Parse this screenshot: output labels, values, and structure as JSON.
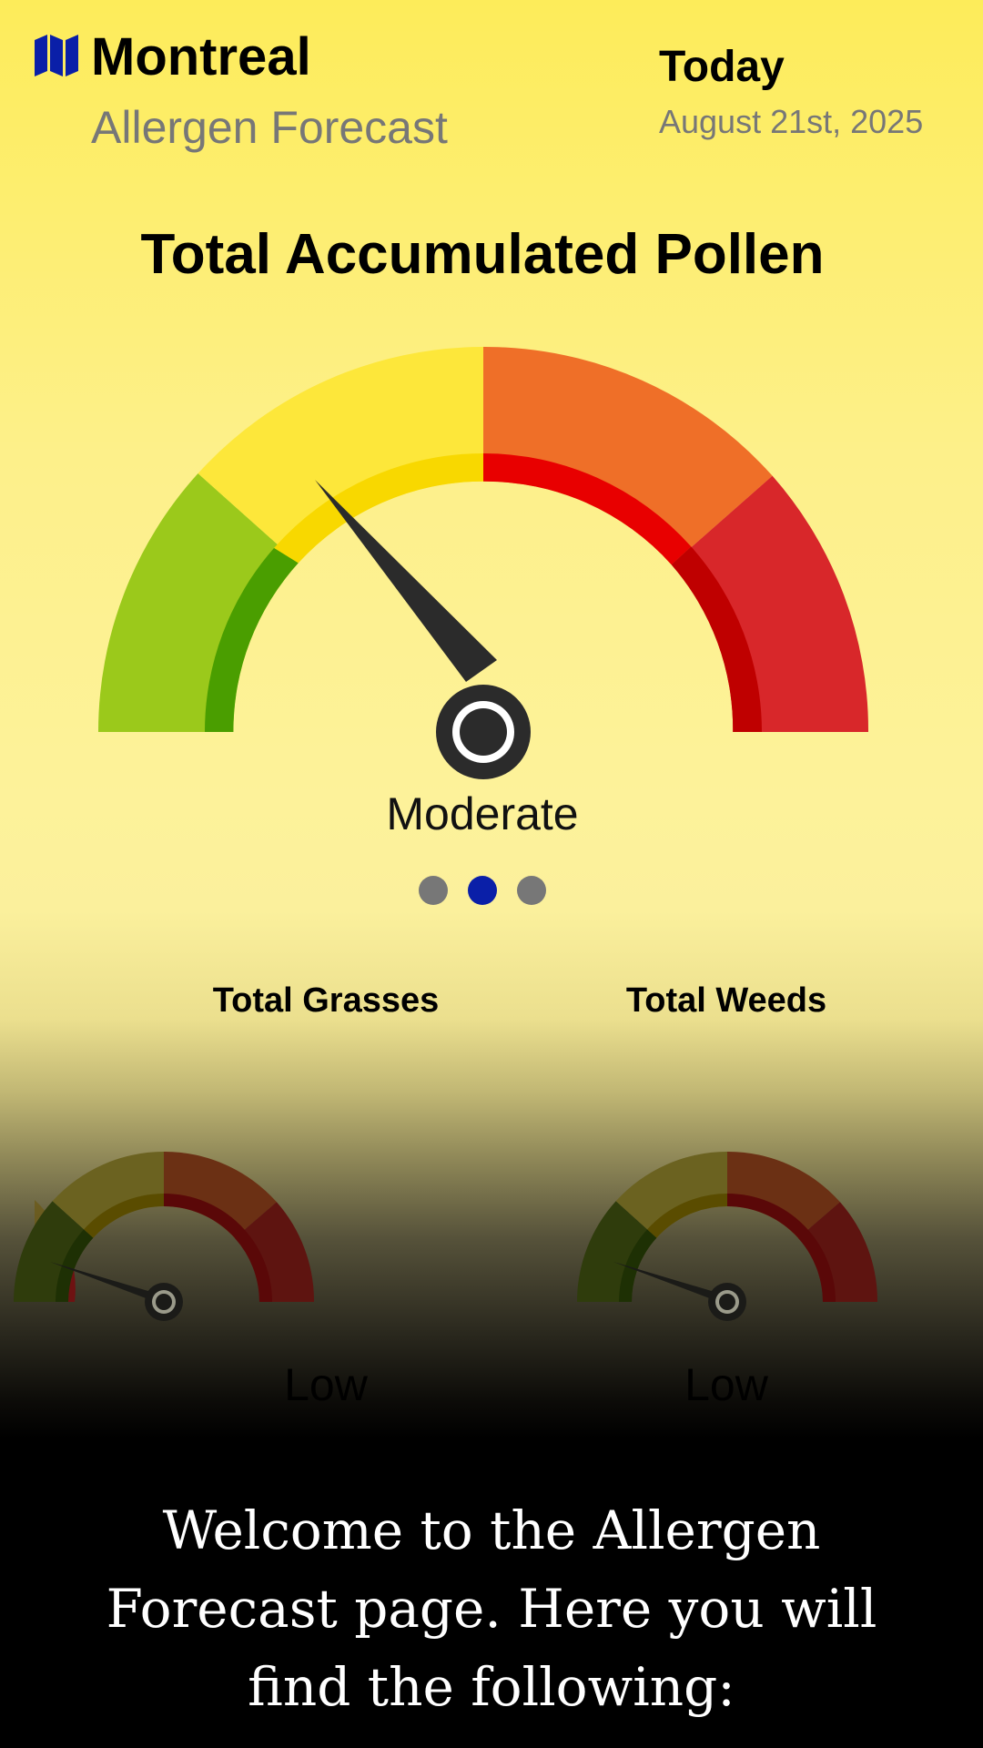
{
  "header": {
    "location_icon": "map-icon",
    "city": "Montreal",
    "subtitle": "Allergen Forecast",
    "day_label": "Today",
    "date": "August 21st, 2025"
  },
  "main_gauge": {
    "title": "Total Accumulated Pollen",
    "level": "Moderate",
    "segment_colors": [
      "#9bc91b",
      "#fde73a",
      "#ef6f28",
      "#d8272a"
    ],
    "inner_colors": [
      "#4a9e00",
      "#f8d800",
      "#e80000",
      "#bf0000"
    ]
  },
  "carousel": {
    "page_count": 3,
    "active_index": 2
  },
  "sub_gauges": [
    {
      "title": "Total Grasses",
      "level": "Low"
    },
    {
      "title": "Total Weeds",
      "level": "Low"
    }
  ],
  "welcome_text": "Welcome to the Allergen Forecast page. Here you will find the following:",
  "colors": {
    "accent": "#0a1fa8",
    "needle": "#2b2b2b",
    "subtitle_gray": "#777777"
  }
}
